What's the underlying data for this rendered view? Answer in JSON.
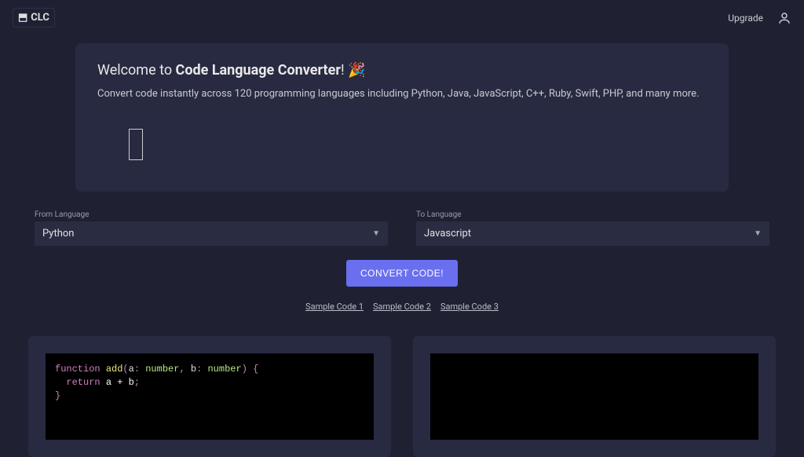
{
  "header": {
    "logo_text": "CLC",
    "upgrade": "Upgrade"
  },
  "welcome": {
    "prefix": "Welcome to ",
    "bold": "Code Language Converter",
    "suffix": "! 🎉",
    "description": "Convert code instantly across 120 programming languages including Python, Java, JavaScript, C++, Ruby, Swift, PHP, and many more."
  },
  "from_select": {
    "label": "From Language",
    "value": "Python"
  },
  "to_select": {
    "label": "To Language",
    "value": "Javascript"
  },
  "convert_button": "CONVERT CODE!",
  "samples": {
    "s1": "Sample Code 1",
    "s2": "Sample Code 2",
    "s3": "Sample Code 3"
  },
  "code": {
    "kw_function": "function",
    "fn_name": "add",
    "paren_open": "(",
    "p1": "a",
    "colon1": ": ",
    "t1": "number",
    "comma": ", ",
    "p2": "b",
    "colon2": ": ",
    "t2": "number",
    "paren_close": ") {",
    "kw_return": "return",
    "expr": " a + b",
    "semi": ";",
    "brace_close": "}"
  }
}
